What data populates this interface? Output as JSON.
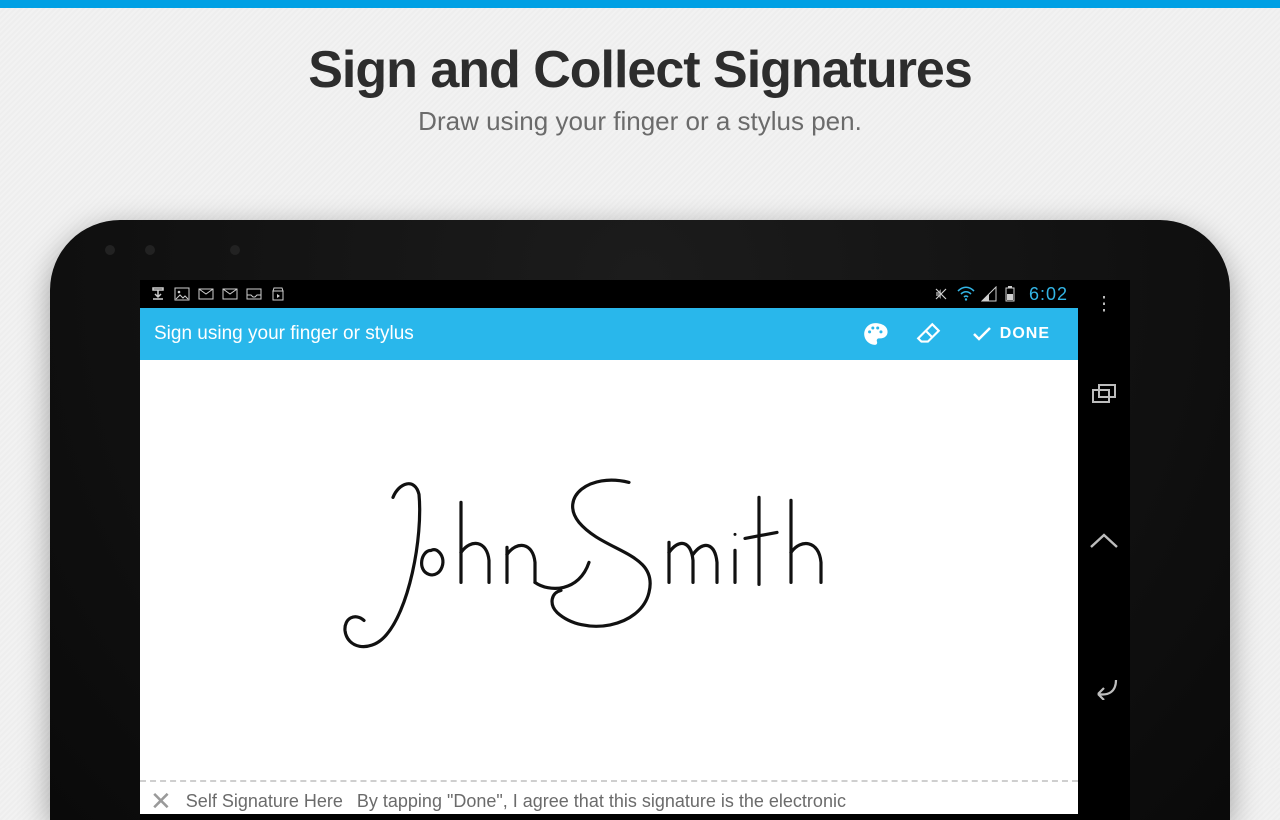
{
  "hero": {
    "title": "Sign and Collect Signatures",
    "subtitle": "Draw using your finger or a stylus pen."
  },
  "status": {
    "time": "6:02"
  },
  "actionbar": {
    "title": "Sign using your finger or stylus",
    "done": "DONE"
  },
  "signature": {
    "name": "John Smith"
  },
  "footer": {
    "placeholder": "Self Signature Here",
    "legal": "By tapping \"Done\", I agree that this signature is the electronic"
  }
}
